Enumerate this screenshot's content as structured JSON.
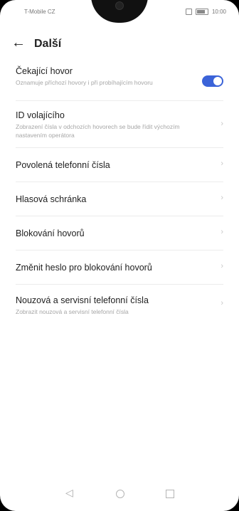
{
  "status_bar": {
    "carrier": "T-Mobile CZ",
    "time": "10:00"
  },
  "header": {
    "title": "Další"
  },
  "items": [
    {
      "title": "Čekající hovor",
      "subtitle": "Oznamuje příchozí hovory i při probíhajícím hovoru",
      "control": "toggle",
      "toggle_on": true
    },
    {
      "title": "ID volajícího",
      "subtitle": "Zobrazení čísla v odchozích hovorech se bude řídit výchozím nastavením operátora",
      "control": "chevron"
    },
    {
      "title": "Povolená telefonní čísla",
      "control": "chevron"
    },
    {
      "title": "Hlasová schránka",
      "control": "chevron"
    },
    {
      "title": "Blokování hovorů",
      "control": "chevron"
    },
    {
      "title": "Změnit heslo pro blokování hovorů",
      "control": "chevron"
    },
    {
      "title": "Nouzová a servisní telefonní čísla",
      "subtitle": "Zobrazit nouzová a servisní telefonní čísla",
      "control": "chevron"
    }
  ],
  "icons": {
    "back": "arrow-left-icon",
    "chevron": "chevron-right-icon",
    "nav_back": "triangle-back-icon",
    "nav_home": "circle-home-icon",
    "nav_recent": "square-recent-icon"
  },
  "colors": {
    "accent": "#3b63d8"
  }
}
